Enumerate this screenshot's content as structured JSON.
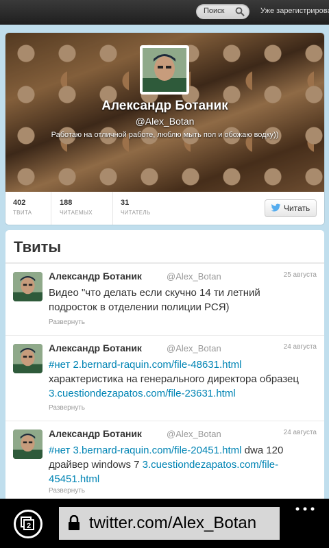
{
  "topbar": {
    "search_label": "Поиск",
    "signin_text": "Уже зарегистрирова"
  },
  "profile": {
    "name": "Александр Ботаник",
    "handle": "@Alex_Botan",
    "bio": "Работаю на отличной работе, люблю мыть пол и обожаю водку))",
    "stats": [
      {
        "value": "402",
        "label": "ТВИТА"
      },
      {
        "value": "188",
        "label": "ЧИТАЕМЫХ"
      },
      {
        "value": "31",
        "label": "ЧИТАТЕЛЬ"
      }
    ],
    "follow_label": "Читать"
  },
  "tweets_section": {
    "title": "Твиты",
    "expand_label": "Развернуть",
    "items": [
      {
        "name": "Александр Ботаник",
        "handle": "@Alex_Botan",
        "date": "25 августа",
        "parts": [
          {
            "t": "Видео \"что делать если скучно 14 ти летний подросток в отделении полиции РСЯ)",
            "link": false
          }
        ]
      },
      {
        "name": "Александр Ботаник",
        "handle": "@Alex_Botan",
        "date": "24 августа",
        "parts": [
          {
            "t": "#нет",
            "link": true
          },
          {
            "t": " ",
            "link": false
          },
          {
            "t": "2.bernard-raquin.com/file-48631.html",
            "link": true
          },
          {
            "t": " характеристика на генерального директора образец ",
            "link": false
          },
          {
            "t": "3.cuestiondezapatos.com/file-23631.html",
            "link": true
          }
        ]
      },
      {
        "name": "Александр Ботаник",
        "handle": "@Alex_Botan",
        "date": "24 августа",
        "parts": [
          {
            "t": "#нет",
            "link": true
          },
          {
            "t": " ",
            "link": false
          },
          {
            "t": "3.bernard-raquin.com/file-20451.html",
            "link": true
          },
          {
            "t": " dwa 120 драйвер windows 7 ",
            "link": false
          },
          {
            "t": "3.cuestiondezapatos.com/file-45451.html",
            "link": true
          }
        ]
      }
    ]
  },
  "browser": {
    "url": "twitter.com/Alex_Botan",
    "tab_count": "2"
  },
  "colors": {
    "link": "#0084b4",
    "page_bg": "#c0deed",
    "twitter_blue": "#55acee"
  }
}
